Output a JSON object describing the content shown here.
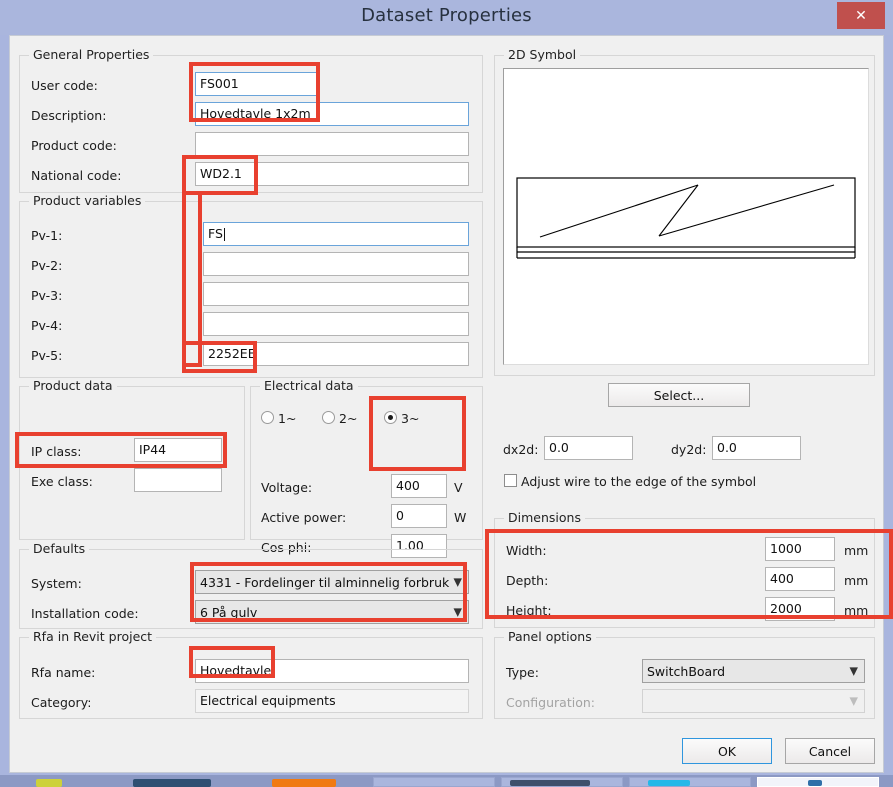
{
  "window": {
    "title": "Dataset Properties",
    "close_label": "✕",
    "close_icon": "close-icon",
    "titlebar_color": "#aab6dd",
    "close_button_color": "#c0504d",
    "annotation_color": "#e8402f"
  },
  "general_properties": {
    "title": "General Properties",
    "fields": [
      {
        "label": "User code:",
        "value": "FS001"
      },
      {
        "label": "Description:",
        "value": "Hovedtavle 1x2m"
      },
      {
        "label": "Product code:",
        "value": ""
      },
      {
        "label": "National code:",
        "value": "WD2.1"
      }
    ]
  },
  "product_variables": {
    "title": "Product variables",
    "fields": [
      {
        "label": "Pv-1:",
        "value": "FS"
      },
      {
        "label": "Pv-2:",
        "value": ""
      },
      {
        "label": "Pv-3:",
        "value": ""
      },
      {
        "label": "Pv-4:",
        "value": ""
      },
      {
        "label": "Pv-5:",
        "value": "2252EE"
      }
    ]
  },
  "product_data": {
    "title": "Product data",
    "fields": [
      {
        "label": "IP class:",
        "value": "IP44"
      },
      {
        "label": "Exe class:",
        "value": ""
      }
    ]
  },
  "electrical_data": {
    "title": "Electrical data",
    "phase_options": [
      {
        "label": "1~",
        "selected": false
      },
      {
        "label": "2~",
        "selected": false
      },
      {
        "label": "3~",
        "selected": true
      }
    ],
    "voltage": {
      "label": "Voltage:",
      "value": "400",
      "unit": "V"
    },
    "active_power": {
      "label": "Active power:",
      "value": "0",
      "unit": "W"
    },
    "cos_phi": {
      "label": "Cos phi:",
      "value": "1.00",
      "unit": ""
    }
  },
  "defaults": {
    "title": "Defaults",
    "system": {
      "label": "System:",
      "value": "4331 - Fordelinger til alminnelig forbruk"
    },
    "installation_code": {
      "label": "Installation code:",
      "value": "6 På gulv"
    }
  },
  "rfa": {
    "title": "Rfa in Revit project",
    "name": {
      "label": "Rfa name:",
      "value": "Hovedtavle"
    },
    "category": {
      "label": "Category:",
      "value": "Electrical equipments"
    }
  },
  "symbol": {
    "title": "2D Symbol",
    "select_button": "Select...",
    "dx2d": {
      "label": "dx2d:",
      "value": "0.0"
    },
    "dy2d": {
      "label": "dy2d:",
      "value": "0.0"
    },
    "adjust_wire": {
      "label": "Adjust wire to the edge of the symbol",
      "checked": false
    }
  },
  "dimensions": {
    "title": "Dimensions",
    "rows": [
      {
        "label": "Width:",
        "value": "1000",
        "unit": "mm"
      },
      {
        "label": "Depth:",
        "value": "400",
        "unit": "mm"
      },
      {
        "label": "Height:",
        "value": "2000",
        "unit": "mm"
      }
    ]
  },
  "panel_options": {
    "title": "Panel options",
    "type": {
      "label": "Type:",
      "value": "SwitchBoard"
    },
    "configuration": {
      "label": "Configuration:",
      "value": "",
      "disabled": true
    }
  },
  "footer": {
    "ok": "OK",
    "cancel": "Cancel"
  }
}
